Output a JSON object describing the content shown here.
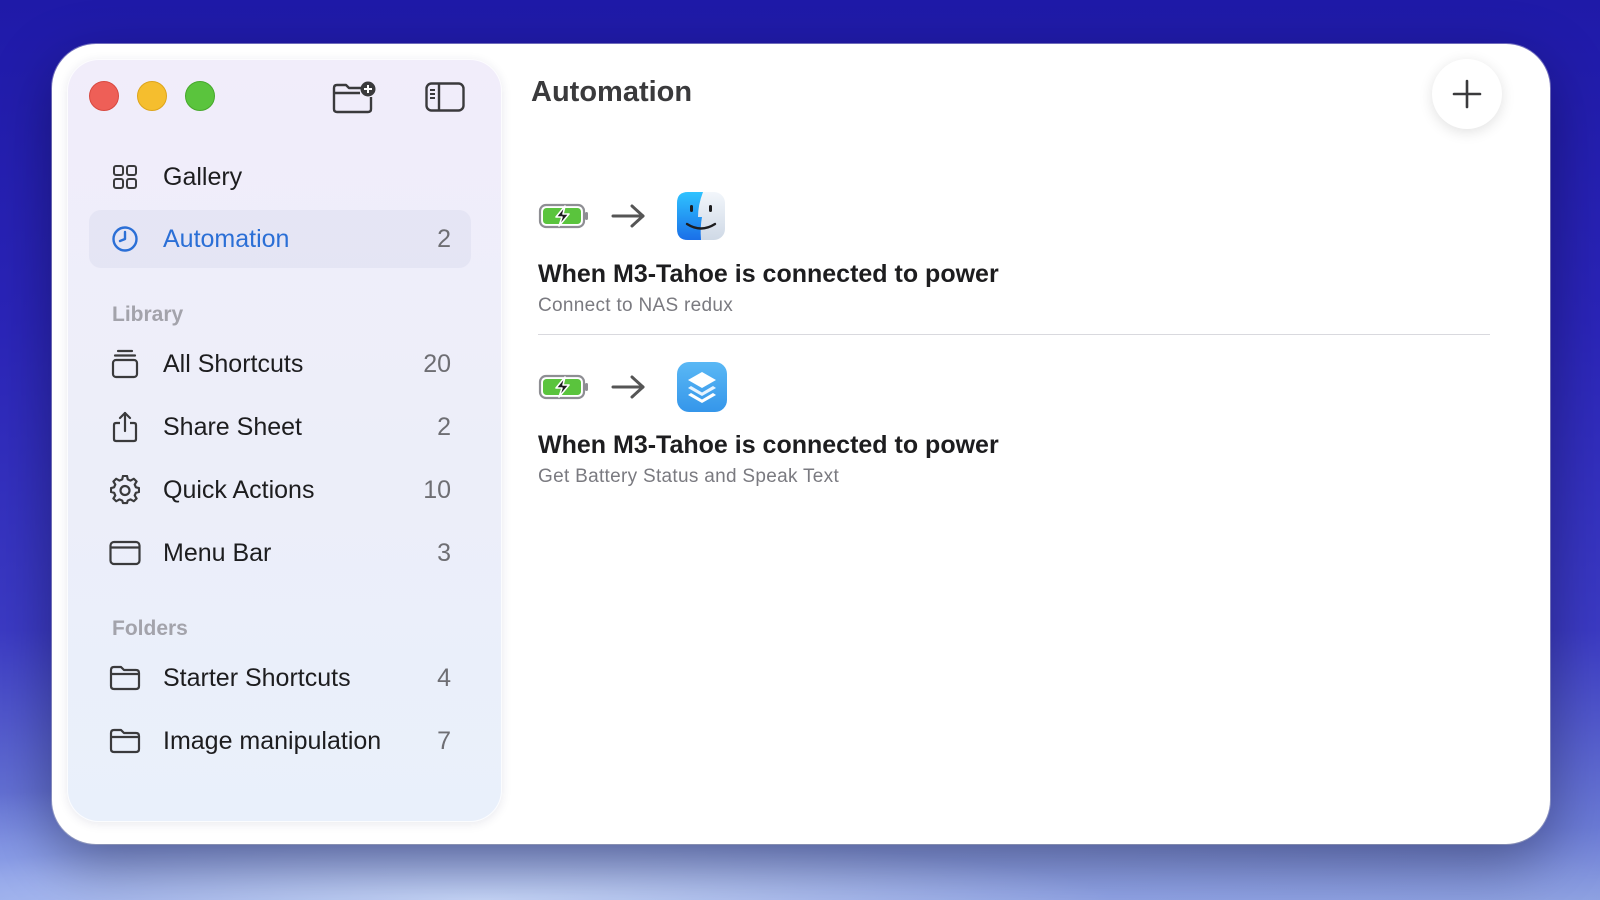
{
  "window": {
    "title": "Automation"
  },
  "toolbar": {
    "new_folder_icon": "folder-plus-icon",
    "toggle_sidebar_icon": "sidebar-icon",
    "add_icon": "plus-icon"
  },
  "sidebar": {
    "top_items": [
      {
        "label": "Gallery",
        "count": "",
        "icon": "grid-icon"
      },
      {
        "label": "Automation",
        "count": "2",
        "icon": "clock-icon",
        "active": true
      }
    ],
    "library_header": "Library",
    "library_items": [
      {
        "label": "All Shortcuts",
        "count": "20",
        "icon": "stack-icon"
      },
      {
        "label": "Share Sheet",
        "count": "2",
        "icon": "share-icon"
      },
      {
        "label": "Quick Actions",
        "count": "10",
        "icon": "gear-icon"
      },
      {
        "label": "Menu Bar",
        "count": "3",
        "icon": "menubar-icon"
      }
    ],
    "folders_header": "Folders",
    "folder_items": [
      {
        "label": "Starter Shortcuts",
        "count": "4",
        "icon": "folder-icon"
      },
      {
        "label": "Image manipulation",
        "count": "7",
        "icon": "folder-icon"
      }
    ]
  },
  "automations": [
    {
      "trigger_icon": "battery-charging-icon",
      "app_icon": "finder-icon",
      "title": "When M3-Tahoe is connected to power",
      "subtitle": "Connect to NAS redux"
    },
    {
      "trigger_icon": "battery-charging-icon",
      "app_icon": "shortcuts-icon",
      "title": "When M3-Tahoe is connected to power",
      "subtitle": "Get Battery Status and Speak Text"
    }
  ],
  "colors": {
    "accent": "#2b6fd6",
    "close": "#ee5f57",
    "minimize": "#f5be2e",
    "zoom": "#5ac43d"
  }
}
